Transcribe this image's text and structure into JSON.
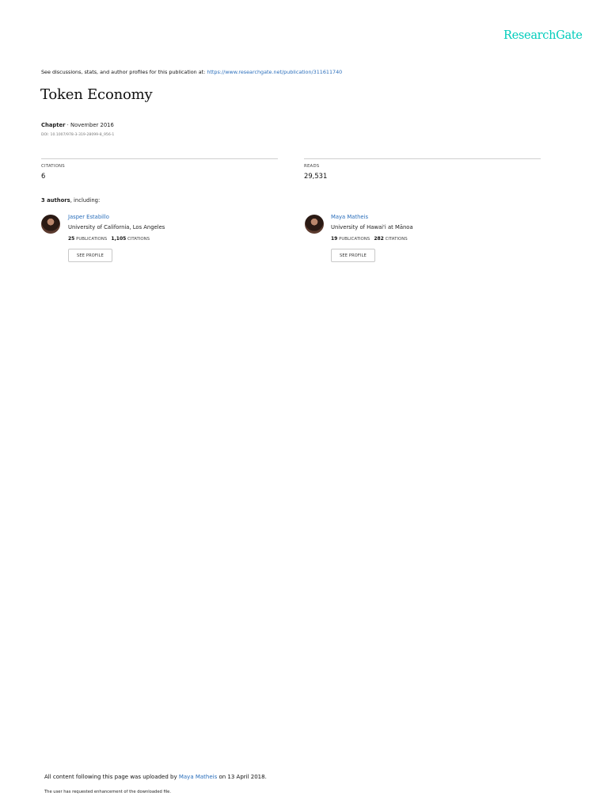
{
  "brand": "ResearchGate",
  "header": {
    "discussion_prefix": "See discussions, stats, and author profiles for this publication at: ",
    "publication_url": "https://www.researchgate.net/publication/311611740"
  },
  "paper": {
    "title": "Token Economy",
    "type": "Chapter",
    "date": " · November 2016",
    "doi": "DOI: 10.1007/978-3-319-28099-8_956-1"
  },
  "stats": {
    "citations_label": "CITATIONS",
    "citations_value": "6",
    "reads_label": "READS",
    "reads_value": "29,531"
  },
  "authors_section": {
    "count": "3 authors",
    "suffix": ", including:"
  },
  "authors": [
    {
      "name": "Jasper Estabillo",
      "institution": "University of California, Los Angeles",
      "publications": "25",
      "publications_label": " PUBLICATIONS",
      "citations": "1,105",
      "citations_label": " CITATIONS",
      "button_label": "SEE PROFILE"
    },
    {
      "name": "Maya Matheis",
      "institution": "University of Hawai'i at Mānoa",
      "publications": "19",
      "publications_label": " PUBLICATIONS",
      "citations": "282",
      "citations_label": " CITATIONS",
      "button_label": "SEE PROFILE"
    }
  ],
  "footer": {
    "upload_prefix": "All content following this page was uploaded by ",
    "uploader": "Maya Matheis",
    "upload_suffix": " on 13 April 2018.",
    "enhancement_note": "The user has requested enhancement of the downloaded file."
  }
}
